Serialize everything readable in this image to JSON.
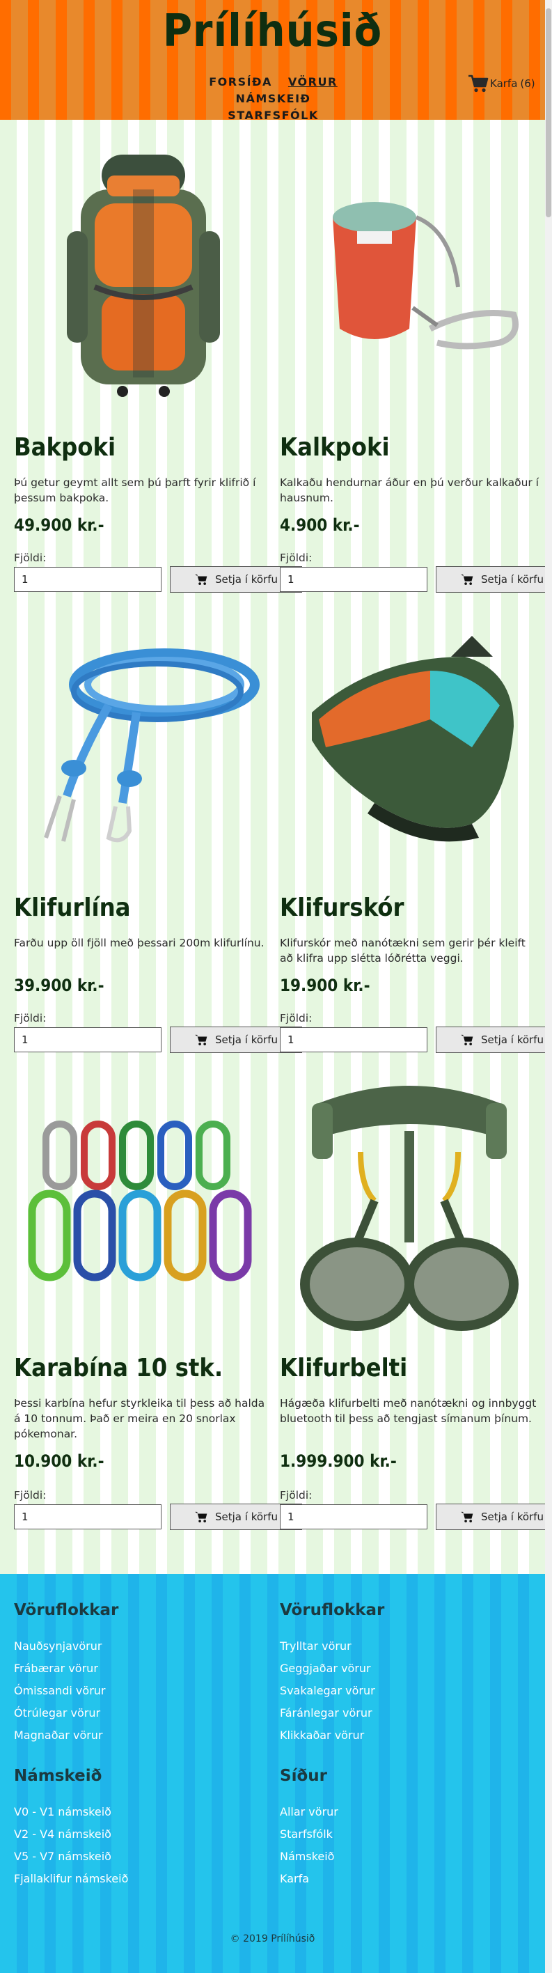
{
  "site": {
    "title": "Prílíhúsið"
  },
  "nav": {
    "items": [
      "FORSÍÐA",
      "VÖRUR",
      "NÁMSKEIÐ",
      "STARFSFÓLK"
    ],
    "active": "VÖRUR"
  },
  "cart": {
    "label": "Karfa",
    "count": "(6)"
  },
  "products": [
    {
      "name": "Bakpoki",
      "description": "Þú getur geymt allt sem þú þarft fyrir klifrið í þessum bakpoka.",
      "price": "49.900 kr.-",
      "qty_label": "Fjöldi:",
      "qty_value": "1",
      "button_label": "Setja í körfu"
    },
    {
      "name": "Kalkpoki",
      "description": "Kalkaðu hendurnar áður en þú verður kalkaður í hausnum.",
      "price": "4.900 kr.-",
      "qty_label": "Fjöldi:",
      "qty_value": "1",
      "button_label": "Setja í körfu"
    },
    {
      "name": "Klifurlína",
      "description": "Farðu upp öll fjöll með þessari 200m klifurlínu.",
      "price": "39.900 kr.-",
      "qty_label": "Fjöldi:",
      "qty_value": "1",
      "button_label": "Setja í körfu"
    },
    {
      "name": "Klifurskór",
      "description": "Klifurskór með nanótækni sem gerir þér kleift að klifra upp slétta lóðrétta veggi.",
      "price": "19.900 kr.-",
      "qty_label": "Fjöldi:",
      "qty_value": "1",
      "button_label": "Setja í körfu"
    },
    {
      "name": "Karabína 10 stk.",
      "description": "Þessi karbína hefur styrkleika til þess að halda á 10 tonnum. Það er meira en 20 snorlax pókemonar.",
      "price": "10.900 kr.-",
      "qty_label": "Fjöldi:",
      "qty_value": "1",
      "button_label": "Setja í körfu"
    },
    {
      "name": "Klifurbelti",
      "description": "Hágæða klifurbelti með nanótækni og innbyggt bluetooth til þess að tengjast símanum þínum.",
      "price": "1.999.900 kr.-",
      "qty_label": "Fjöldi:",
      "qty_value": "1",
      "button_label": "Setja í körfu"
    }
  ],
  "footer": {
    "columns": [
      {
        "heading": "Vöruflokkar",
        "links": [
          "Nauðsynjavörur",
          "Frábærar vörur",
          "Ómissandi vörur",
          "Ótrúlegar vörur",
          "Magnaðar vörur"
        ]
      },
      {
        "heading": "Vöruflokkar",
        "links": [
          "Trylltar vörur",
          "Geggjaðar vörur",
          "Svakalegar vörur",
          "Fáránlegar vörur",
          "Klikkaðar vörur"
        ]
      },
      {
        "heading": "Námskeið",
        "links": [
          "V0 - V1 námskeið",
          "V2 - V4 námskeið",
          "V5 - V7 námskeið",
          "Fjallaklifur námskeið"
        ]
      },
      {
        "heading": "Síður",
        "links": [
          "Allar vörur",
          "Starfsfólk",
          "Námskeið",
          "Karfa"
        ]
      }
    ],
    "copyright": "© 2019 Prílíhúsið"
  },
  "colors": {
    "header_orange": "#ff6d00",
    "header_stripe": "#e8892c",
    "main_green": "#e6f7e0",
    "footer_blue": "#24c4ec",
    "title_dark_green": "#0f2e10"
  },
  "icons": {
    "cart": "cart-icon",
    "add_to_cart": "cart-icon"
  }
}
